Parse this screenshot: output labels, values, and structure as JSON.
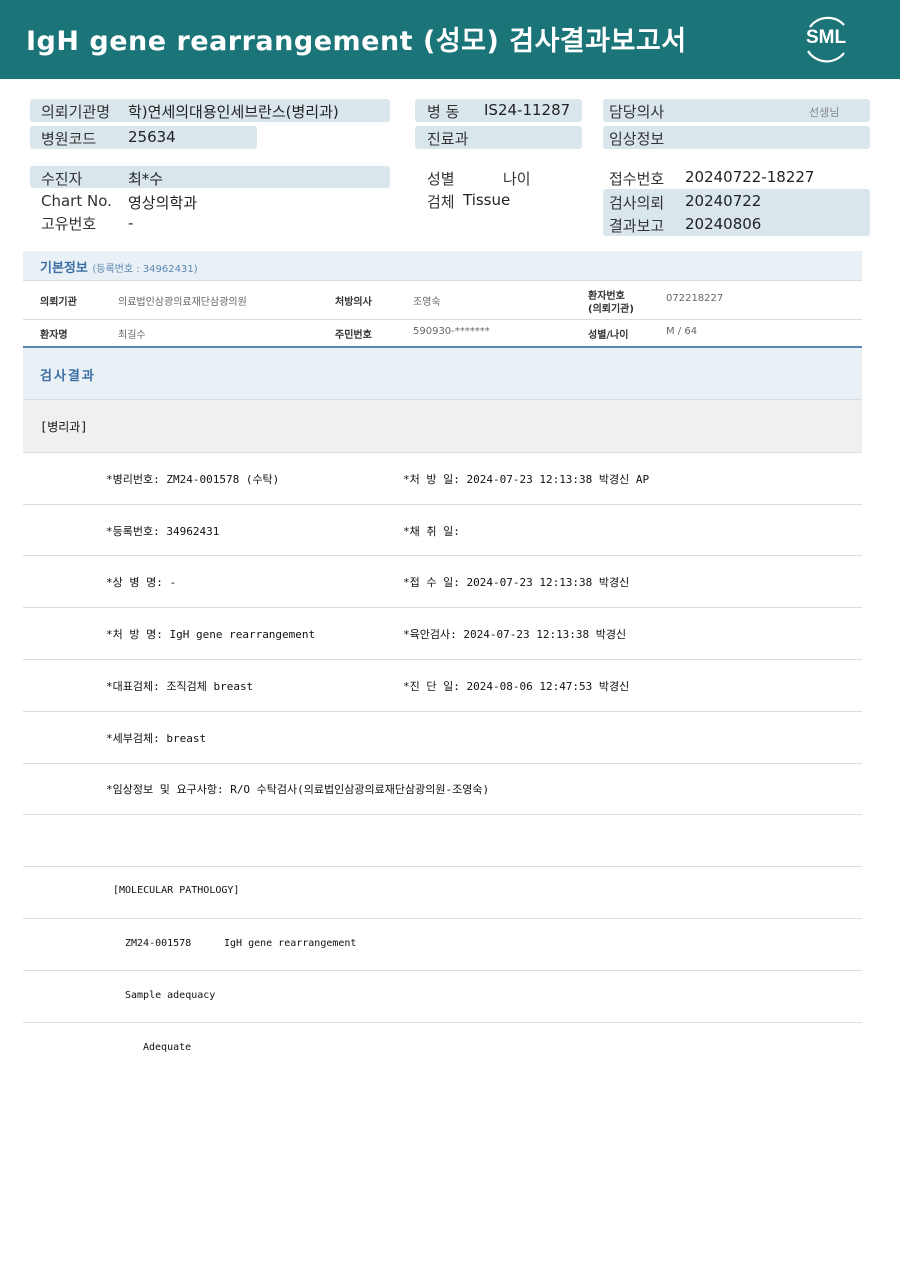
{
  "header": {
    "title": "IgH gene rearrangement (성모) 검사결과보고서",
    "logo_text": "SML",
    "bg_color": "#1a7478"
  },
  "info": {
    "institution_label": "의뢰기관명",
    "institution_value": "학)연세의대용인세브란스(병리과)",
    "ward_label": "병 동",
    "ward_value": "IS24-11287",
    "doctor_label": "담당의사",
    "doctor_suffix": "선생님",
    "hospital_code_label": "병원코드",
    "hospital_code_value": "25634",
    "dept_label": "진료과",
    "clinical_label": "임상정보",
    "patient_label": "수진자",
    "patient_value": "최*수",
    "sex_label": "성별",
    "age_label": "나이",
    "receipt_label": "접수번호",
    "receipt_value": "20240722-18227",
    "chart_label": "Chart No.",
    "chart_value": "영상의학과",
    "specimen_label": "검체",
    "specimen_value": "Tissue",
    "request_label": "검사의뢰",
    "request_value": "20240722",
    "uid_label": "고유번호",
    "uid_value": "-",
    "report_label": "결과보고",
    "report_value": "20240806"
  },
  "basic": {
    "title": "기본정보",
    "subtitle": "(등록번호 : 34962431)",
    "inst_label": "의뢰기관",
    "inst_value": "의료법인삼광의료재단삼광의원",
    "prescriber_label": "처방의사",
    "prescriber_value": "조영숙",
    "patient_no_label": "환자번호",
    "patient_no_label2": "(의뢰기관)",
    "patient_no_value": "072218227",
    "name_label": "환자명",
    "name_value": "최길수",
    "rrn_label": "주민번호",
    "rrn_value": "590930-*******",
    "sexage_label": "성별/나이",
    "sexage_value": "M / 64"
  },
  "results": {
    "title": "검사결과",
    "dept": "[병리과]",
    "rows": [
      {
        "left": "*병리번호: ZM24-001578 (수탁)",
        "right": "*처 방 일: 2024-07-23 12:13:38  박경신 AP"
      },
      {
        "left": "*등록번호: 34962431",
        "right": "*채 취 일:"
      },
      {
        "left": "*상 병 명: -",
        "right": "*접 수 일: 2024-07-23 12:13:38  박경신"
      },
      {
        "left": "*처 방 명: IgH gene rearrangement",
        "right": "*육안검사: 2024-07-23 12:13:38  박경신"
      },
      {
        "left": "*대표검체: 조직검체 breast",
        "right": "*진 단 일: 2024-08-06 12:47:53  박경신"
      },
      {
        "left": "*세부검체: breast",
        "right": ""
      },
      {
        "left": "*임상정보 및 요구사항: R/O 수탁검사(의료법인삼광의료재단삼광의원-조영숙)",
        "right": ""
      }
    ],
    "molecular_title": "[MOLECULAR PATHOLOGY]",
    "molecular_id": "ZM24-001578",
    "molecular_test": "IgH gene rearrangement",
    "sample_label": "Sample adequacy",
    "sample_value": "Adequate"
  }
}
